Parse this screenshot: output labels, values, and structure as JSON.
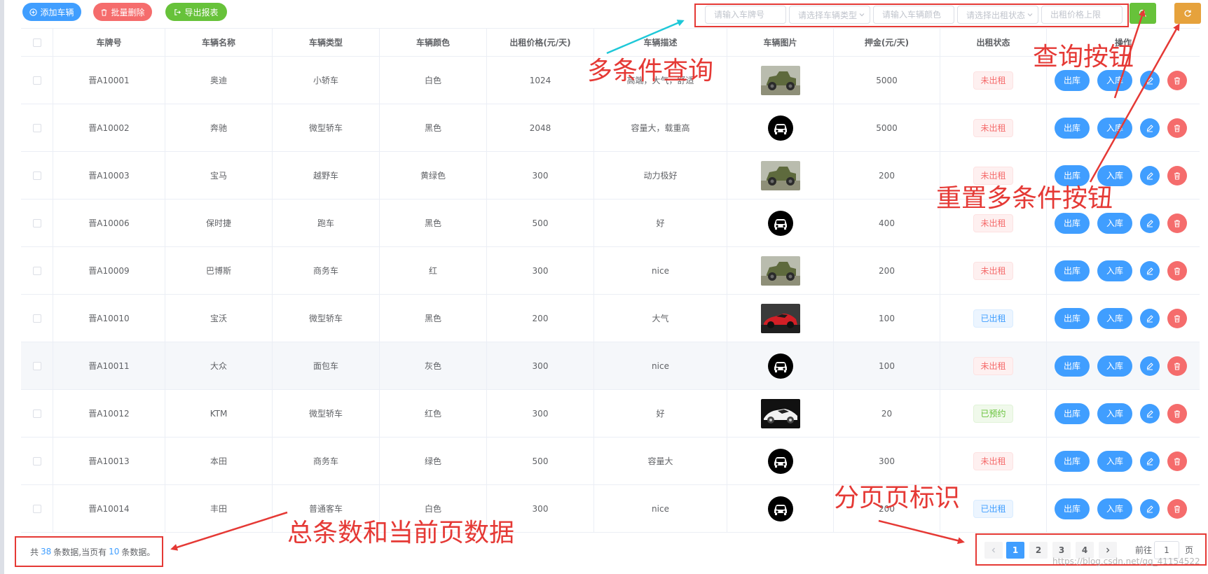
{
  "toolbar": {
    "add_label": "添加车辆",
    "batch_delete_label": "批量删除",
    "export_label": "导出报表"
  },
  "search": {
    "plate_placeholder": "请输入车牌号",
    "type_placeholder": "请选择车辆类型",
    "color_placeholder": "请输入车辆颜色",
    "status_placeholder": "请选择出租状态",
    "price_placeholder": "出租价格上限"
  },
  "table": {
    "columns": [
      "车牌号",
      "车辆名称",
      "车辆类型",
      "车辆颜色",
      "出租价格(元/天)",
      "车辆描述",
      "车辆图片",
      "押金(元/天)",
      "出租状态",
      "操作"
    ],
    "rows": [
      {
        "plate": "晋A10001",
        "name": "奥迪",
        "type": "小轿车",
        "color": "白色",
        "price": "1024",
        "desc": "高端，大气，舒适",
        "image": "jeep-photo",
        "deposit": "5000",
        "status": "未出租",
        "status_kind": "red"
      },
      {
        "plate": "晋A10002",
        "name": "奔驰",
        "type": "微型轿车",
        "color": "黑色",
        "price": "2048",
        "desc": "容量大，载重高",
        "image": "car-logo",
        "deposit": "5000",
        "status": "未出租",
        "status_kind": "red"
      },
      {
        "plate": "晋A10003",
        "name": "宝马",
        "type": "越野车",
        "color": "黄绿色",
        "price": "300",
        "desc": "动力极好",
        "image": "jeep-photo",
        "deposit": "200",
        "status": "未出租",
        "status_kind": "red"
      },
      {
        "plate": "晋A10006",
        "name": "保时捷",
        "type": "跑车",
        "color": "黑色",
        "price": "500",
        "desc": "好",
        "image": "car-logo",
        "deposit": "400",
        "status": "未出租",
        "status_kind": "red"
      },
      {
        "plate": "晋A10009",
        "name": "巴博斯",
        "type": "商务车",
        "color": "红",
        "price": "300",
        "desc": "nice",
        "image": "jeep-photo",
        "deposit": "200",
        "status": "未出租",
        "status_kind": "red"
      },
      {
        "plate": "晋A10010",
        "name": "宝沃",
        "type": "微型轿车",
        "color": "黑色",
        "price": "200",
        "desc": "大气",
        "image": "red-sportscar-photo",
        "deposit": "100",
        "status": "已出租",
        "status_kind": "blue"
      },
      {
        "plate": "晋A10011",
        "name": "大众",
        "type": "面包车",
        "color": "灰色",
        "price": "300",
        "desc": "nice",
        "image": "car-logo",
        "deposit": "100",
        "status": "未出租",
        "status_kind": "red"
      },
      {
        "plate": "晋A10012",
        "name": "KTM",
        "type": "微型轿车",
        "color": "红色",
        "price": "300",
        "desc": "好",
        "image": "white-sportscar-photo",
        "deposit": "20",
        "status": "已预约",
        "status_kind": "green"
      },
      {
        "plate": "晋A10013",
        "name": "本田",
        "type": "商务车",
        "color": "绿色",
        "price": "500",
        "desc": "容量大",
        "image": "car-logo",
        "deposit": "300",
        "status": "未出租",
        "status_kind": "red"
      },
      {
        "plate": "晋A10014",
        "name": "丰田",
        "type": "普通客车",
        "color": "白色",
        "price": "300",
        "desc": "nice",
        "image": "car-logo",
        "deposit": "200",
        "status": "已出租",
        "status_kind": "blue"
      }
    ],
    "op_out_label": "出库",
    "op_in_label": "入库"
  },
  "footer": {
    "summary_prefix": "共",
    "total": "38",
    "summary_mid": "条数据,当页有",
    "page_count": "10",
    "summary_suffix": "条数据。",
    "pages": [
      "1",
      "2",
      "3",
      "4"
    ],
    "active_page": "1",
    "goto_prefix": "前往",
    "goto_value": "1",
    "goto_suffix": "页",
    "watermark": "https://blog.csdn.net/qq_41154522"
  },
  "annotations": {
    "multi_query": "多条件查询",
    "query_button": "查询按钮",
    "reset_button": "重置多条件按钮",
    "pagination": "分页页标识",
    "summary": "总条数和当前页数据"
  },
  "colors": {
    "primary": "#409eff",
    "danger": "#f56c6c",
    "success": "#67c23a",
    "warning": "#e6a23c",
    "annotation": "#e53935",
    "annotation_arrow_cyan": "#1ec8d8"
  },
  "icons": {
    "add": "plus-circle-icon",
    "delete": "trash-icon",
    "export": "export-icon",
    "search": "search-icon",
    "reset": "refresh-icon",
    "edit": "pencil-icon",
    "remove": "trash-icon",
    "prev": "chevron-left-icon",
    "next": "chevron-right-icon"
  }
}
